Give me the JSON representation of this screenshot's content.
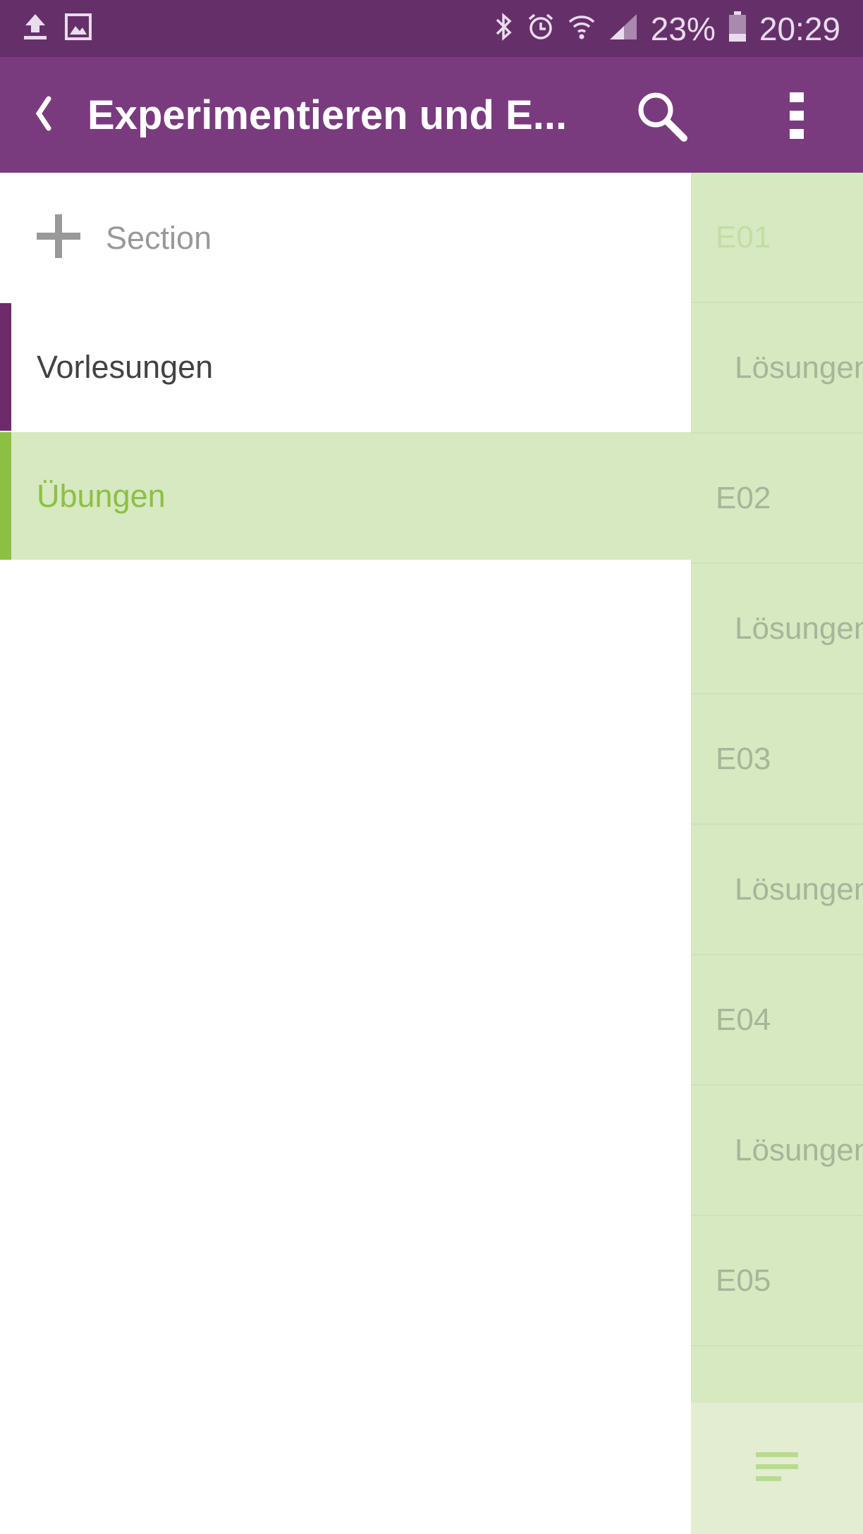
{
  "status_bar": {
    "battery": "23%",
    "time": "20:29",
    "icons": [
      "upload-icon",
      "image-icon",
      "bluetooth-icon",
      "alarm-icon",
      "wifi-icon",
      "signal-icon",
      "battery-icon"
    ]
  },
  "app_bar": {
    "title": "Experimentieren und E...",
    "icons": [
      "back-chevron-icon",
      "search-icon",
      "more-vert-icon"
    ]
  },
  "sections": {
    "add_label": "Section",
    "items": [
      {
        "label": "Vorlesungen",
        "color": "#6e2b6c"
      },
      {
        "label": "Übungen",
        "color": "#8dc042",
        "selected": true
      }
    ]
  },
  "pages": {
    "items": [
      {
        "label": "E01",
        "level": 0,
        "selected": true
      },
      {
        "label": "Lösungen",
        "level": 1
      },
      {
        "label": "E02",
        "level": 0
      },
      {
        "label": "Lösungen",
        "level": 1
      },
      {
        "label": "E03",
        "level": 0
      },
      {
        "label": "Lösungen",
        "level": 1
      },
      {
        "label": "E04",
        "level": 0
      },
      {
        "label": "Lösungen",
        "level": 1
      },
      {
        "label": "E05",
        "level": 0
      }
    ],
    "footer_icon": "hamburger-menu-icon"
  },
  "colors": {
    "status_bar": "#65306a",
    "app_bar": "#7a3b7e",
    "section_selected_bg": "#d6e9c1",
    "accent_green": "#8dc042"
  }
}
